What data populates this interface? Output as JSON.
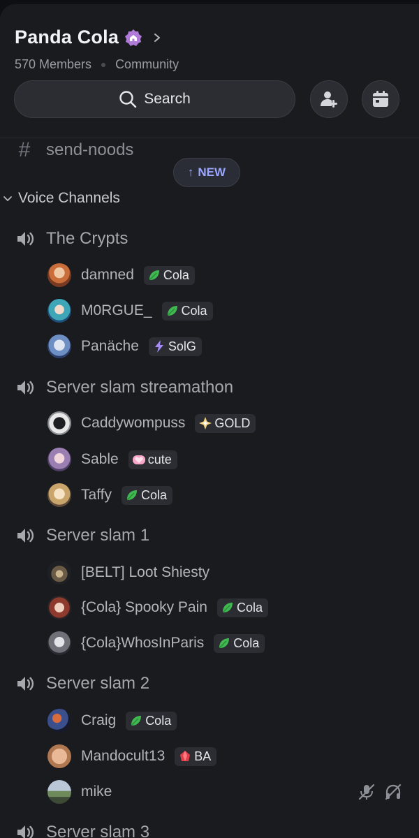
{
  "server": {
    "name": "Panda Cola",
    "members": "570 Members",
    "type": "Community"
  },
  "search": {
    "label": "Search"
  },
  "text_channel": {
    "name": "send-noods"
  },
  "new_pill": {
    "label": "NEW"
  },
  "category": {
    "label": "Voice Channels"
  },
  "voice_channels": [
    {
      "name": "The Crypts",
      "members": [
        {
          "name": "damned",
          "tag": "Cola",
          "tag_icon": "leaf-icon"
        },
        {
          "name": "M0RGUE_",
          "tag": "Cola",
          "tag_icon": "leaf-icon"
        },
        {
          "name": "Panäche",
          "tag": "SolG",
          "tag_icon": "lightning-icon"
        }
      ]
    },
    {
      "name": "Server slam streamathon",
      "members": [
        {
          "name": "Caddywompuss",
          "tag": "GOLD",
          "tag_icon": "sparkle-icon"
        },
        {
          "name": "Sable",
          "tag": "cute",
          "tag_icon": "heart-icon"
        },
        {
          "name": "Taffy",
          "tag": "Cola",
          "tag_icon": "leaf-icon"
        }
      ]
    },
    {
      "name": "Server slam 1",
      "members": [
        {
          "name": "[BELT] Loot Shiesty"
        },
        {
          "name": "{Cola} Spooky Pain",
          "tag": "Cola",
          "tag_icon": "leaf-icon"
        },
        {
          "name": "{Cola}WhosInParis",
          "tag": "Cola",
          "tag_icon": "leaf-icon"
        }
      ]
    },
    {
      "name": "Server slam 2",
      "members": [
        {
          "name": "Craig",
          "tag": "Cola",
          "tag_icon": "leaf-icon"
        },
        {
          "name": "Mandocult13",
          "tag": "BA",
          "tag_icon": "gem-icon"
        },
        {
          "name": "mike",
          "status_icons": [
            "mic-muted-icon",
            "headphones-deafened-icon"
          ]
        }
      ]
    },
    {
      "name": "Server slam 3",
      "members": []
    }
  ],
  "colors": {
    "background": "#1a1b1f",
    "accent_new": "#9ba8ff",
    "leaf_green": "#3fb950",
    "boost_purple": "#b07ad9"
  }
}
